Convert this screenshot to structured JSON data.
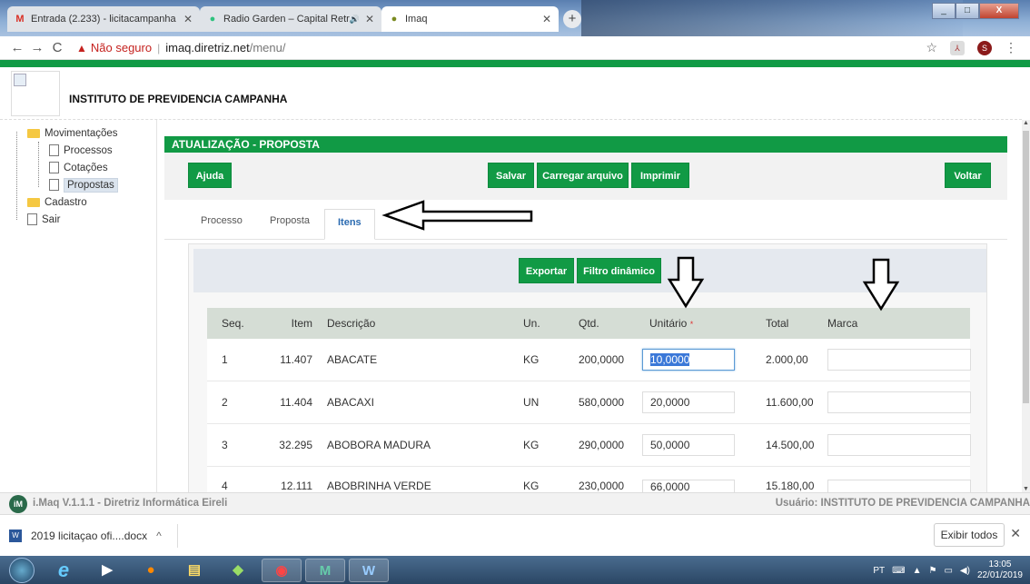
{
  "browser": {
    "tabs": [
      {
        "label": "Entrada (2.233) - licitacampanha",
        "icon": "gmail-icon"
      },
      {
        "label": "Radio Garden – Capital Retrô",
        "icon": "radio-icon",
        "audio": "🔊"
      },
      {
        "label": "Imaq",
        "icon": "imaq-icon"
      }
    ],
    "security": "Não seguro",
    "url_host": "imaq.diretriz.net",
    "url_path": "/menu/",
    "profile_initial": "S"
  },
  "header": {
    "org_name": "INSTITUTO DE PREVIDENCIA CAMPANHA"
  },
  "sidebar": {
    "items": [
      {
        "label": "Movimentações",
        "type": "folder-open"
      },
      {
        "label": "Processos",
        "type": "doc"
      },
      {
        "label": "Cotações",
        "type": "doc"
      },
      {
        "label": "Propostas",
        "type": "doc",
        "selected": true
      },
      {
        "label": "Cadastro",
        "type": "folder"
      },
      {
        "label": "Sair",
        "type": "doc"
      }
    ]
  },
  "main": {
    "title": "ATUALIZAÇÃO - PROPOSTA",
    "toolbar": {
      "help": "Ajuda",
      "save": "Salvar",
      "upload": "Carregar arquivo",
      "print": "Imprimir",
      "back": "Voltar"
    },
    "tabs": [
      {
        "label": "Processo"
      },
      {
        "label": "Proposta"
      },
      {
        "label": "Itens",
        "active": true
      }
    ],
    "panel": {
      "export": "Exportar",
      "filter": "Filtro dinâmico"
    },
    "table": {
      "columns": [
        "Seq.",
        "Item",
        "Descrição",
        "Un.",
        "Qtd.",
        "Unitário",
        "Total",
        "Marca"
      ],
      "required_mark": "*",
      "rows": [
        {
          "seq": "1",
          "item": "11.407",
          "desc": "ABACATE",
          "un": "KG",
          "qtd": "200,0000",
          "unit": "10,0000",
          "total": "2.000,00",
          "marca": ""
        },
        {
          "seq": "2",
          "item": "11.404",
          "desc": "ABACAXI",
          "un": "UN",
          "qtd": "580,0000",
          "unit": "20,0000",
          "total": "11.600,00",
          "marca": ""
        },
        {
          "seq": "3",
          "item": "32.295",
          "desc": "ABOBORA MADURA",
          "un": "KG",
          "qtd": "290,0000",
          "unit": "50,0000",
          "total": "14.500,00",
          "marca": ""
        },
        {
          "seq": "4",
          "item": "12.111",
          "desc": "ABOBRINHA VERDE",
          "un": "KG",
          "qtd": "230,0000",
          "unit": "66,0000",
          "total": "15.180,00",
          "marca": ""
        }
      ]
    }
  },
  "footer": {
    "version": "i.Maq V.1.1.1 - Diretriz Informática Eireli",
    "user": "Usuário: INSTITUTO DE PREVIDENCIA CAMPANHA"
  },
  "downloads": {
    "file": "2019 licitaçao ofi....docx",
    "show_all": "Exibir todos"
  },
  "taskbar": {
    "lang": "PT",
    "time": "13:05",
    "date": "22/01/2019"
  },
  "colors": {
    "accent": "#119a45",
    "header_row": "#d5ddd5"
  }
}
